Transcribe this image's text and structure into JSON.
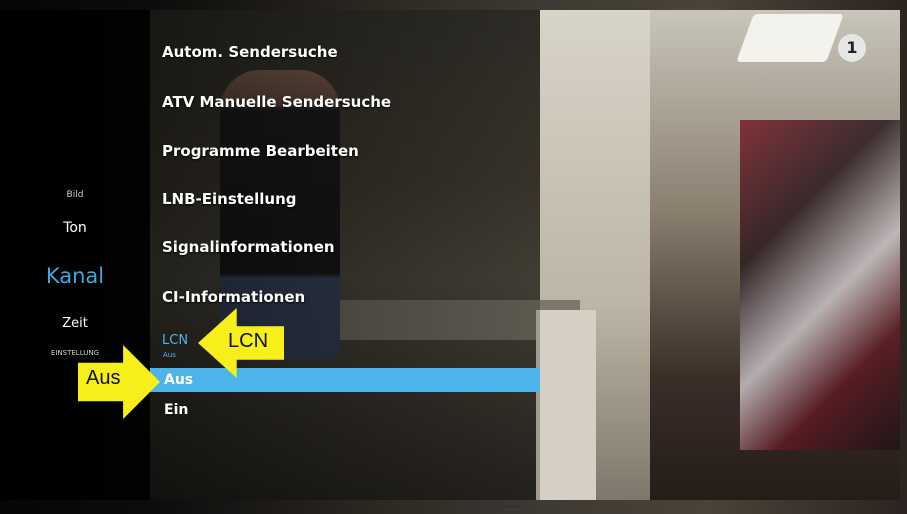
{
  "logo": {
    "text": "1",
    "icon": "ard-logo-icon"
  },
  "side_menu": {
    "items": [
      {
        "label": "Bild",
        "state": "normal"
      },
      {
        "label": "Ton",
        "state": "normal"
      },
      {
        "label": "Kanal",
        "state": "active"
      },
      {
        "label": "Zeit",
        "state": "normal"
      },
      {
        "label": "EINSTELLUNG",
        "state": "normal"
      }
    ]
  },
  "channel_menu": {
    "items": [
      "Autom. Sendersuche",
      "ATV Manuelle Sendersuche",
      "Programme Bearbeiten",
      "LNB-Einstellung",
      "Signalinformationen",
      "CI-Informationen"
    ],
    "lcn": {
      "label": "LCN",
      "current_value": "Aus"
    },
    "options": [
      {
        "label": "Aus",
        "selected": true
      },
      {
        "label": "Ein",
        "selected": false
      }
    ]
  },
  "annotations": {
    "aus_arrow": "Aus",
    "lcn_arrow": "LCN",
    "color": "#f7ef19"
  },
  "colors": {
    "accent": "#4cb4e8",
    "active_category": "#3fa9de"
  }
}
